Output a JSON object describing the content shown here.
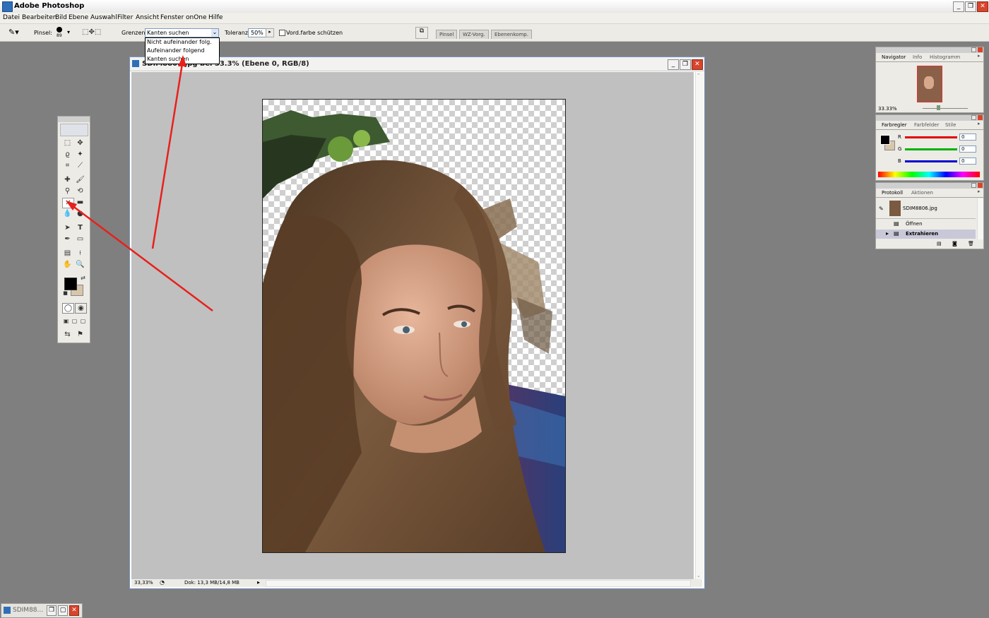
{
  "app": {
    "title": "Adobe Photoshop"
  },
  "menu": [
    "Datei",
    "Bearbeiten",
    "Bild",
    "Ebene",
    "Auswahl",
    "Filter",
    "Ansicht",
    "Fenster",
    "onOne",
    "Hilfe"
  ],
  "options": {
    "brush_label": "Pinsel:",
    "brush_size": "89",
    "borders_label": "Grenzen:",
    "borders_value": "Kanten suchen",
    "borders_options": [
      "Nicht aufeinander folg.",
      "Aufeinander folgend",
      "Kanten suchen"
    ],
    "tolerance_label": "Toleranz:",
    "tolerance_value": "50%",
    "protect_fg_label": "Vord.farbe schützen",
    "palette_tabs": [
      "Pinsel",
      "WZ-Vorg.",
      "Ebenenkomp."
    ]
  },
  "document": {
    "title": "SDIM8806.jpg bei 33.3% (Ebene 0, RGB/8)",
    "zoom": "33,33%",
    "doc_info": "Dok: 13,3 MB/14,8 MB"
  },
  "navigator": {
    "tabs": [
      "Navigator",
      "Info",
      "Histogramm"
    ],
    "zoom": "33.33%"
  },
  "color": {
    "tabs": [
      "Farbregler",
      "Farbfelder",
      "Stile"
    ],
    "channels": [
      {
        "label": "R",
        "value": "0",
        "color": "#e00000"
      },
      {
        "label": "G",
        "value": "0",
        "color": "#00b000"
      },
      {
        "label": "B",
        "value": "0",
        "color": "#0000d0"
      }
    ]
  },
  "history": {
    "tabs": [
      "Protokoll",
      "Aktionen"
    ],
    "snapshot": "SDIM8806.jpg",
    "steps": [
      "Öffnen",
      "Extrahieren"
    ]
  },
  "taskbar": {
    "item": "SDIM88..."
  },
  "colors": {
    "annotation_arrow": "#e8201c",
    "workspace": "#7f7f7f"
  }
}
